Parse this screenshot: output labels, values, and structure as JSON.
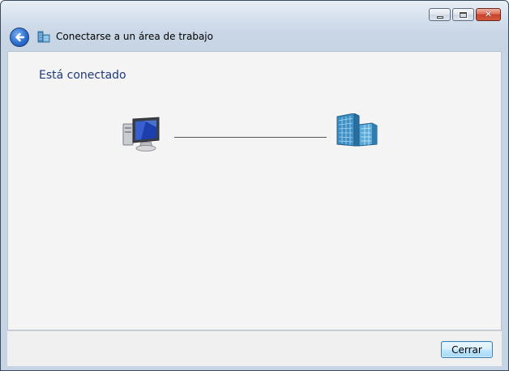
{
  "window": {
    "title": "Conectarse a un área de trabajo",
    "controls": {
      "minimize_icon": "minimize-icon",
      "maximize_icon": "maximize-icon",
      "close_icon": "close-icon",
      "close_color": "#c7402a"
    }
  },
  "navigation": {
    "back_icon": "back-arrow-icon",
    "header_icon": "workplace-connection-icon"
  },
  "content": {
    "heading": "Está conectado",
    "heading_color": "#1e3a7a",
    "diagram": {
      "left_icon": "computer-icon",
      "right_icon": "workplace-building-icon",
      "connection_state": "connected"
    }
  },
  "footer": {
    "close_button_label": "Cerrar"
  }
}
